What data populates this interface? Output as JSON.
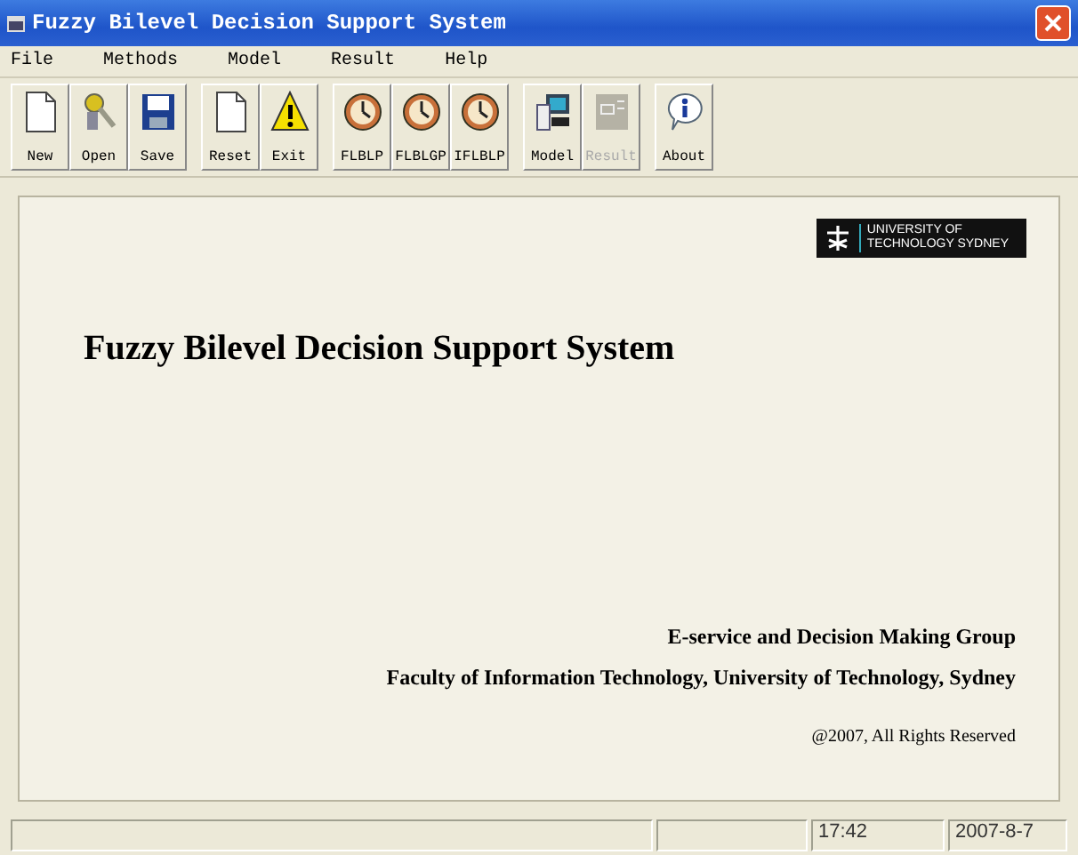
{
  "window": {
    "title": "Fuzzy Bilevel Decision Support System"
  },
  "menu": [
    "File",
    "Methods",
    "Model",
    "Result",
    "Help"
  ],
  "toolbar": [
    [
      {
        "label": "New",
        "kind": "page",
        "disabled": false
      },
      {
        "label": "Open",
        "kind": "keys",
        "disabled": false
      },
      {
        "label": "Save",
        "kind": "disk",
        "disabled": false
      }
    ],
    [
      {
        "label": "Reset",
        "kind": "page",
        "disabled": false
      },
      {
        "label": "Exit",
        "kind": "warning",
        "disabled": false
      }
    ],
    [
      {
        "label": "FLBLP",
        "kind": "clock",
        "disabled": false
      },
      {
        "label": "FLBLGP",
        "kind": "clock",
        "disabled": false
      },
      {
        "label": "IFLBLP",
        "kind": "clock",
        "disabled": false
      }
    ],
    [
      {
        "label": "Model",
        "kind": "computer",
        "disabled": false
      },
      {
        "label": "Result",
        "kind": "form",
        "disabled": true
      }
    ],
    [
      {
        "label": "About",
        "kind": "info",
        "disabled": false
      }
    ]
  ],
  "content": {
    "logo": [
      "UNIVERSITY OF",
      "TECHNOLOGY SYDNEY"
    ],
    "heading": "Fuzzy Bilevel Decision Support System",
    "group": "E-service and Decision Making Group",
    "faculty": "Faculty of Information Technology, University of Technology, Sydney",
    "copyright": "@2007, All Rights Reserved"
  },
  "status_bar": {
    "time": "17:42",
    "date": "2007-8-7"
  }
}
